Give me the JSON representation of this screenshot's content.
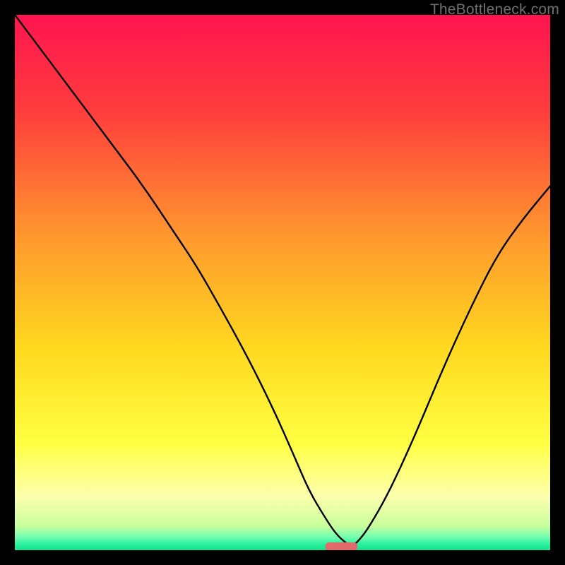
{
  "watermark": "TheBottleneck.com",
  "chart_data": {
    "type": "line",
    "title": "",
    "xlabel": "",
    "ylabel": "",
    "xlim": [
      0,
      100
    ],
    "ylim": [
      0,
      100
    ],
    "gradient_stops": [
      {
        "offset": 0,
        "color": "#ff1450"
      },
      {
        "offset": 0.18,
        "color": "#ff3d3d"
      },
      {
        "offset": 0.42,
        "color": "#ff9a2e"
      },
      {
        "offset": 0.62,
        "color": "#ffd81f"
      },
      {
        "offset": 0.8,
        "color": "#ffff42"
      },
      {
        "offset": 0.9,
        "color": "#fdffad"
      },
      {
        "offset": 0.955,
        "color": "#c8ff9c"
      },
      {
        "offset": 0.975,
        "color": "#74ffb0"
      },
      {
        "offset": 0.99,
        "color": "#25ef9b"
      },
      {
        "offset": 1.0,
        "color": "#18e08d"
      }
    ],
    "series": [
      {
        "name": "bottleneck-curve",
        "x": [
          0,
          6,
          12,
          18,
          24,
          30,
          34,
          38,
          43,
          48,
          52,
          55,
          58,
          60,
          62,
          63,
          64,
          66,
          70,
          75,
          80,
          85,
          90,
          95,
          100
        ],
        "y": [
          100,
          92,
          84,
          76,
          68,
          59,
          53,
          46,
          37,
          27,
          18,
          11,
          6,
          3,
          1.2,
          0.8,
          1.5,
          4,
          11,
          22,
          34,
          45,
          55,
          62,
          68
        ]
      }
    ],
    "marker": {
      "name": "optimal-range-marker",
      "x_center": 61,
      "width": 6,
      "color": "#e26a6a"
    }
  }
}
